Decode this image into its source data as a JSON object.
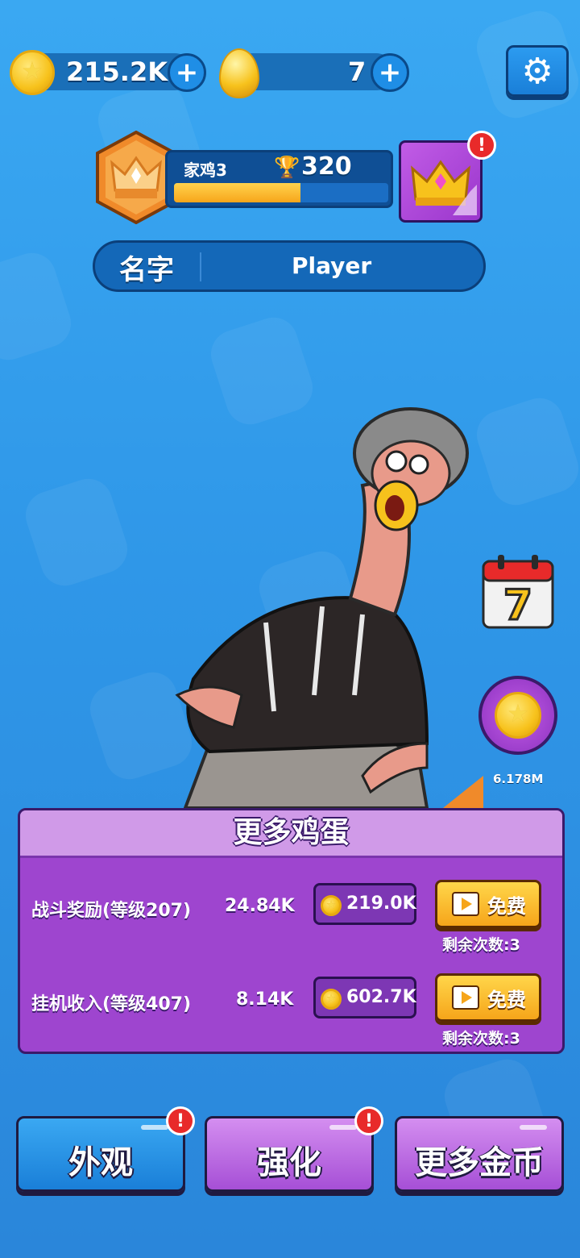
{
  "currency": {
    "coins": "215.2K",
    "eggs": "7"
  },
  "player": {
    "rank_title": "家鸡3",
    "trophies": "320",
    "rank_progress": 0.59,
    "name_label": "名字",
    "name_value": "Player"
  },
  "side": {
    "calendar_day": "7",
    "coin_amount": "6.178M"
  },
  "eggs_panel": {
    "title": "更多鸡蛋",
    "rows": [
      {
        "label": "战斗奖励(等级207)",
        "amount": "24.84K",
        "cost": "219.0K",
        "free_label": "免费",
        "remaining": "剩余次数:3"
      },
      {
        "label": "挂机收入(等级407)",
        "amount": "8.14K",
        "cost": "602.7K",
        "free_label": "免费",
        "remaining": "剩余次数:3"
      }
    ]
  },
  "bottom_buttons": {
    "appearance": "外观",
    "upgrade": "强化",
    "more_coins": "更多金币"
  },
  "alerts": {
    "mark": "!"
  },
  "colors": {
    "accent_blue": "#2f97e8",
    "panel_purple": "#9e45cf",
    "button_gold": "#f6a51a"
  }
}
